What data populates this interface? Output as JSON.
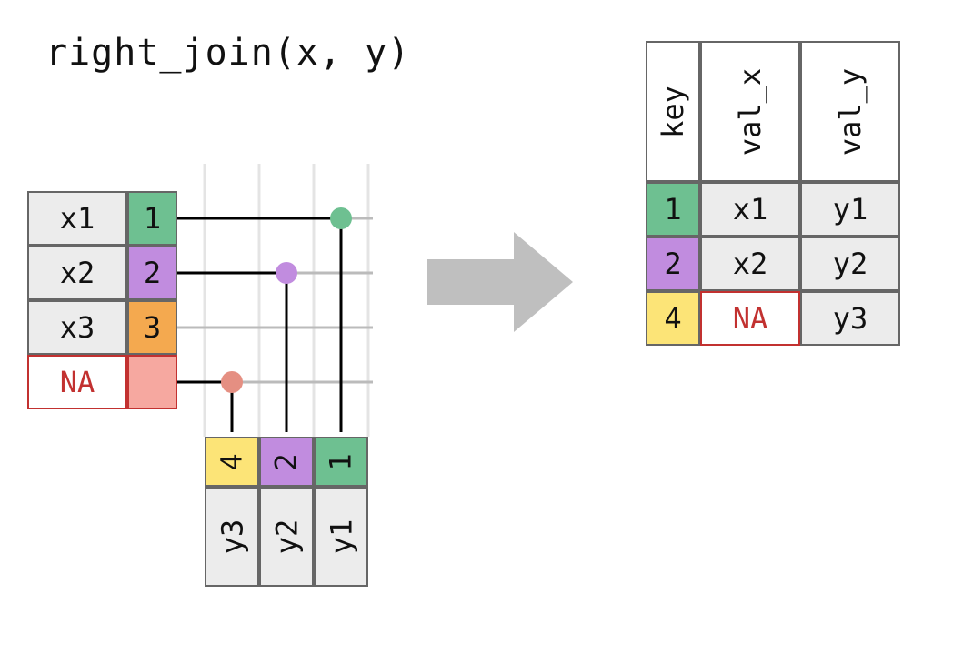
{
  "title": "right_join(x, y)",
  "x_table": {
    "rows": [
      {
        "val": "x1",
        "key": "1",
        "key_color": "k-green"
      },
      {
        "val": "x2",
        "key": "2",
        "key_color": "k-purple"
      },
      {
        "val": "x3",
        "key": "3",
        "key_color": "k-orange"
      }
    ],
    "na_val": "NA"
  },
  "y_table": {
    "cols": [
      {
        "key": "4",
        "key_color": "k-yellow",
        "val": "y3"
      },
      {
        "key": "2",
        "key_color": "k-purple",
        "val": "y2"
      },
      {
        "key": "1",
        "key_color": "k-green",
        "val": "y1"
      }
    ]
  },
  "result_table": {
    "headers": {
      "key": "key",
      "val_x": "val_x",
      "val_y": "val_y"
    },
    "rows": [
      {
        "key": "1",
        "key_color": "k-green",
        "val_x": "x1",
        "val_y": "y1",
        "na": false
      },
      {
        "key": "2",
        "key_color": "k-purple",
        "val_x": "x2",
        "val_y": "y2",
        "na": false
      },
      {
        "key": "4",
        "key_color": "k-yellow",
        "val_x": "NA",
        "val_y": "y3",
        "na": true
      }
    ]
  },
  "colors": {
    "dot_green": "#6ec091",
    "dot_purple": "#c18cdf",
    "dot_red": "#e58f82",
    "grid_grey": "#ccc",
    "arrow_grey": "#bfbfbf"
  },
  "chart_data": {
    "type": "table",
    "operation": "right_join",
    "inputs": {
      "x": [
        {
          "key": 1,
          "val_x": "x1"
        },
        {
          "key": 2,
          "val_x": "x2"
        },
        {
          "key": 3,
          "val_x": "x3"
        }
      ],
      "y": [
        {
          "key": 1,
          "val_y": "y1"
        },
        {
          "key": 2,
          "val_y": "y2"
        },
        {
          "key": 4,
          "val_y": "y3"
        }
      ]
    },
    "output": [
      {
        "key": 1,
        "val_x": "x1",
        "val_y": "y1"
      },
      {
        "key": 2,
        "val_x": "x2",
        "val_y": "y2"
      },
      {
        "key": 4,
        "val_x": null,
        "val_y": "y3"
      }
    ]
  }
}
